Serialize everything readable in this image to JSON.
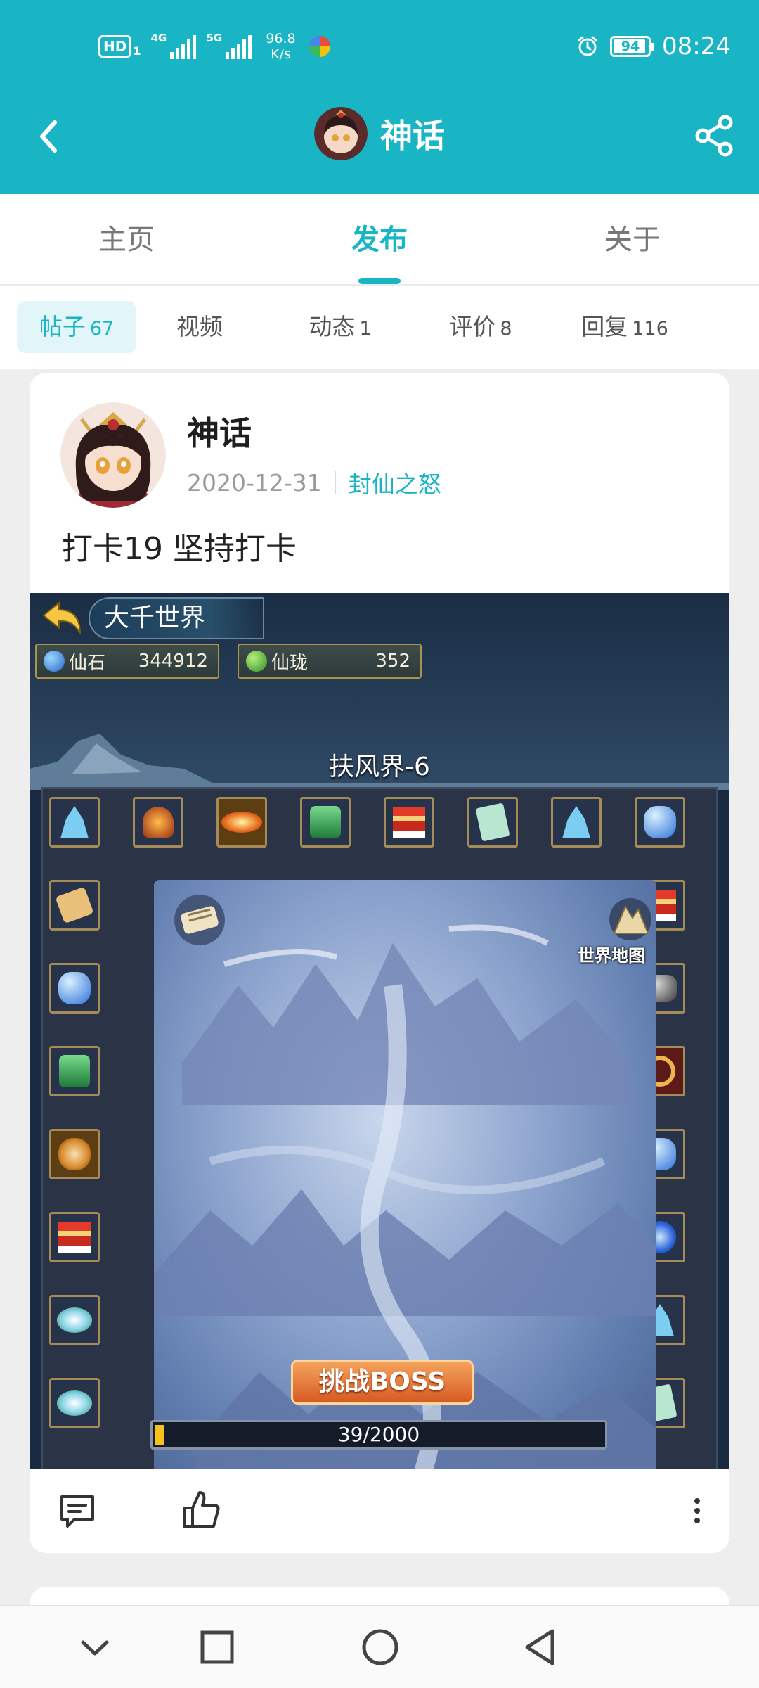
{
  "status_bar": {
    "hd_label": "HD",
    "sim1_label": "1",
    "network1": "4G",
    "network2": "5G",
    "speed_value": "96.8",
    "speed_unit": "K/s",
    "battery": "94",
    "battery_level_percent": 94,
    "time": "08:24"
  },
  "app_bar": {
    "title": "神话",
    "back_icon": "back-chevron-icon",
    "share_icon": "share-icon"
  },
  "main_tabs": [
    {
      "label": "主页",
      "active": false
    },
    {
      "label": "发布",
      "active": true
    },
    {
      "label": "关于",
      "active": false
    }
  ],
  "sub_tabs": [
    {
      "label": "帖子",
      "count": "67",
      "active": true
    },
    {
      "label": "视频",
      "count": "",
      "active": false
    },
    {
      "label": "动态",
      "count": "1",
      "active": false
    },
    {
      "label": "评价",
      "count": "8",
      "active": false
    },
    {
      "label": "回复",
      "count": "116",
      "active": false
    }
  ],
  "post": {
    "author": "神话",
    "date": "2020-12-31",
    "game": "封仙之怒",
    "text": "打卡19 坚持打卡",
    "image": {
      "title": "大千世界",
      "resource1": {
        "label": "仙石",
        "value": "344912"
      },
      "resource2": {
        "label": "仙珑",
        "value": "352"
      },
      "map_name": "扶风界-6",
      "world_map_label": "世界地图",
      "boss_button": "挑战BOSS",
      "progress_text": "39/2000",
      "progress_fraction": 0.0195
    },
    "actions": {
      "comment_icon": "comment-icon",
      "like_icon": "thumbs-up-icon",
      "more_icon": "more-vertical-icon"
    }
  },
  "nav_bar": {
    "icons": [
      "chevron-down-icon",
      "square-icon",
      "circle-icon",
      "triangle-back-icon"
    ]
  },
  "colors": {
    "brand": "#19b5c4",
    "active_subtab_bg": "#e2f5f8",
    "page_bg": "#eeeeee"
  }
}
